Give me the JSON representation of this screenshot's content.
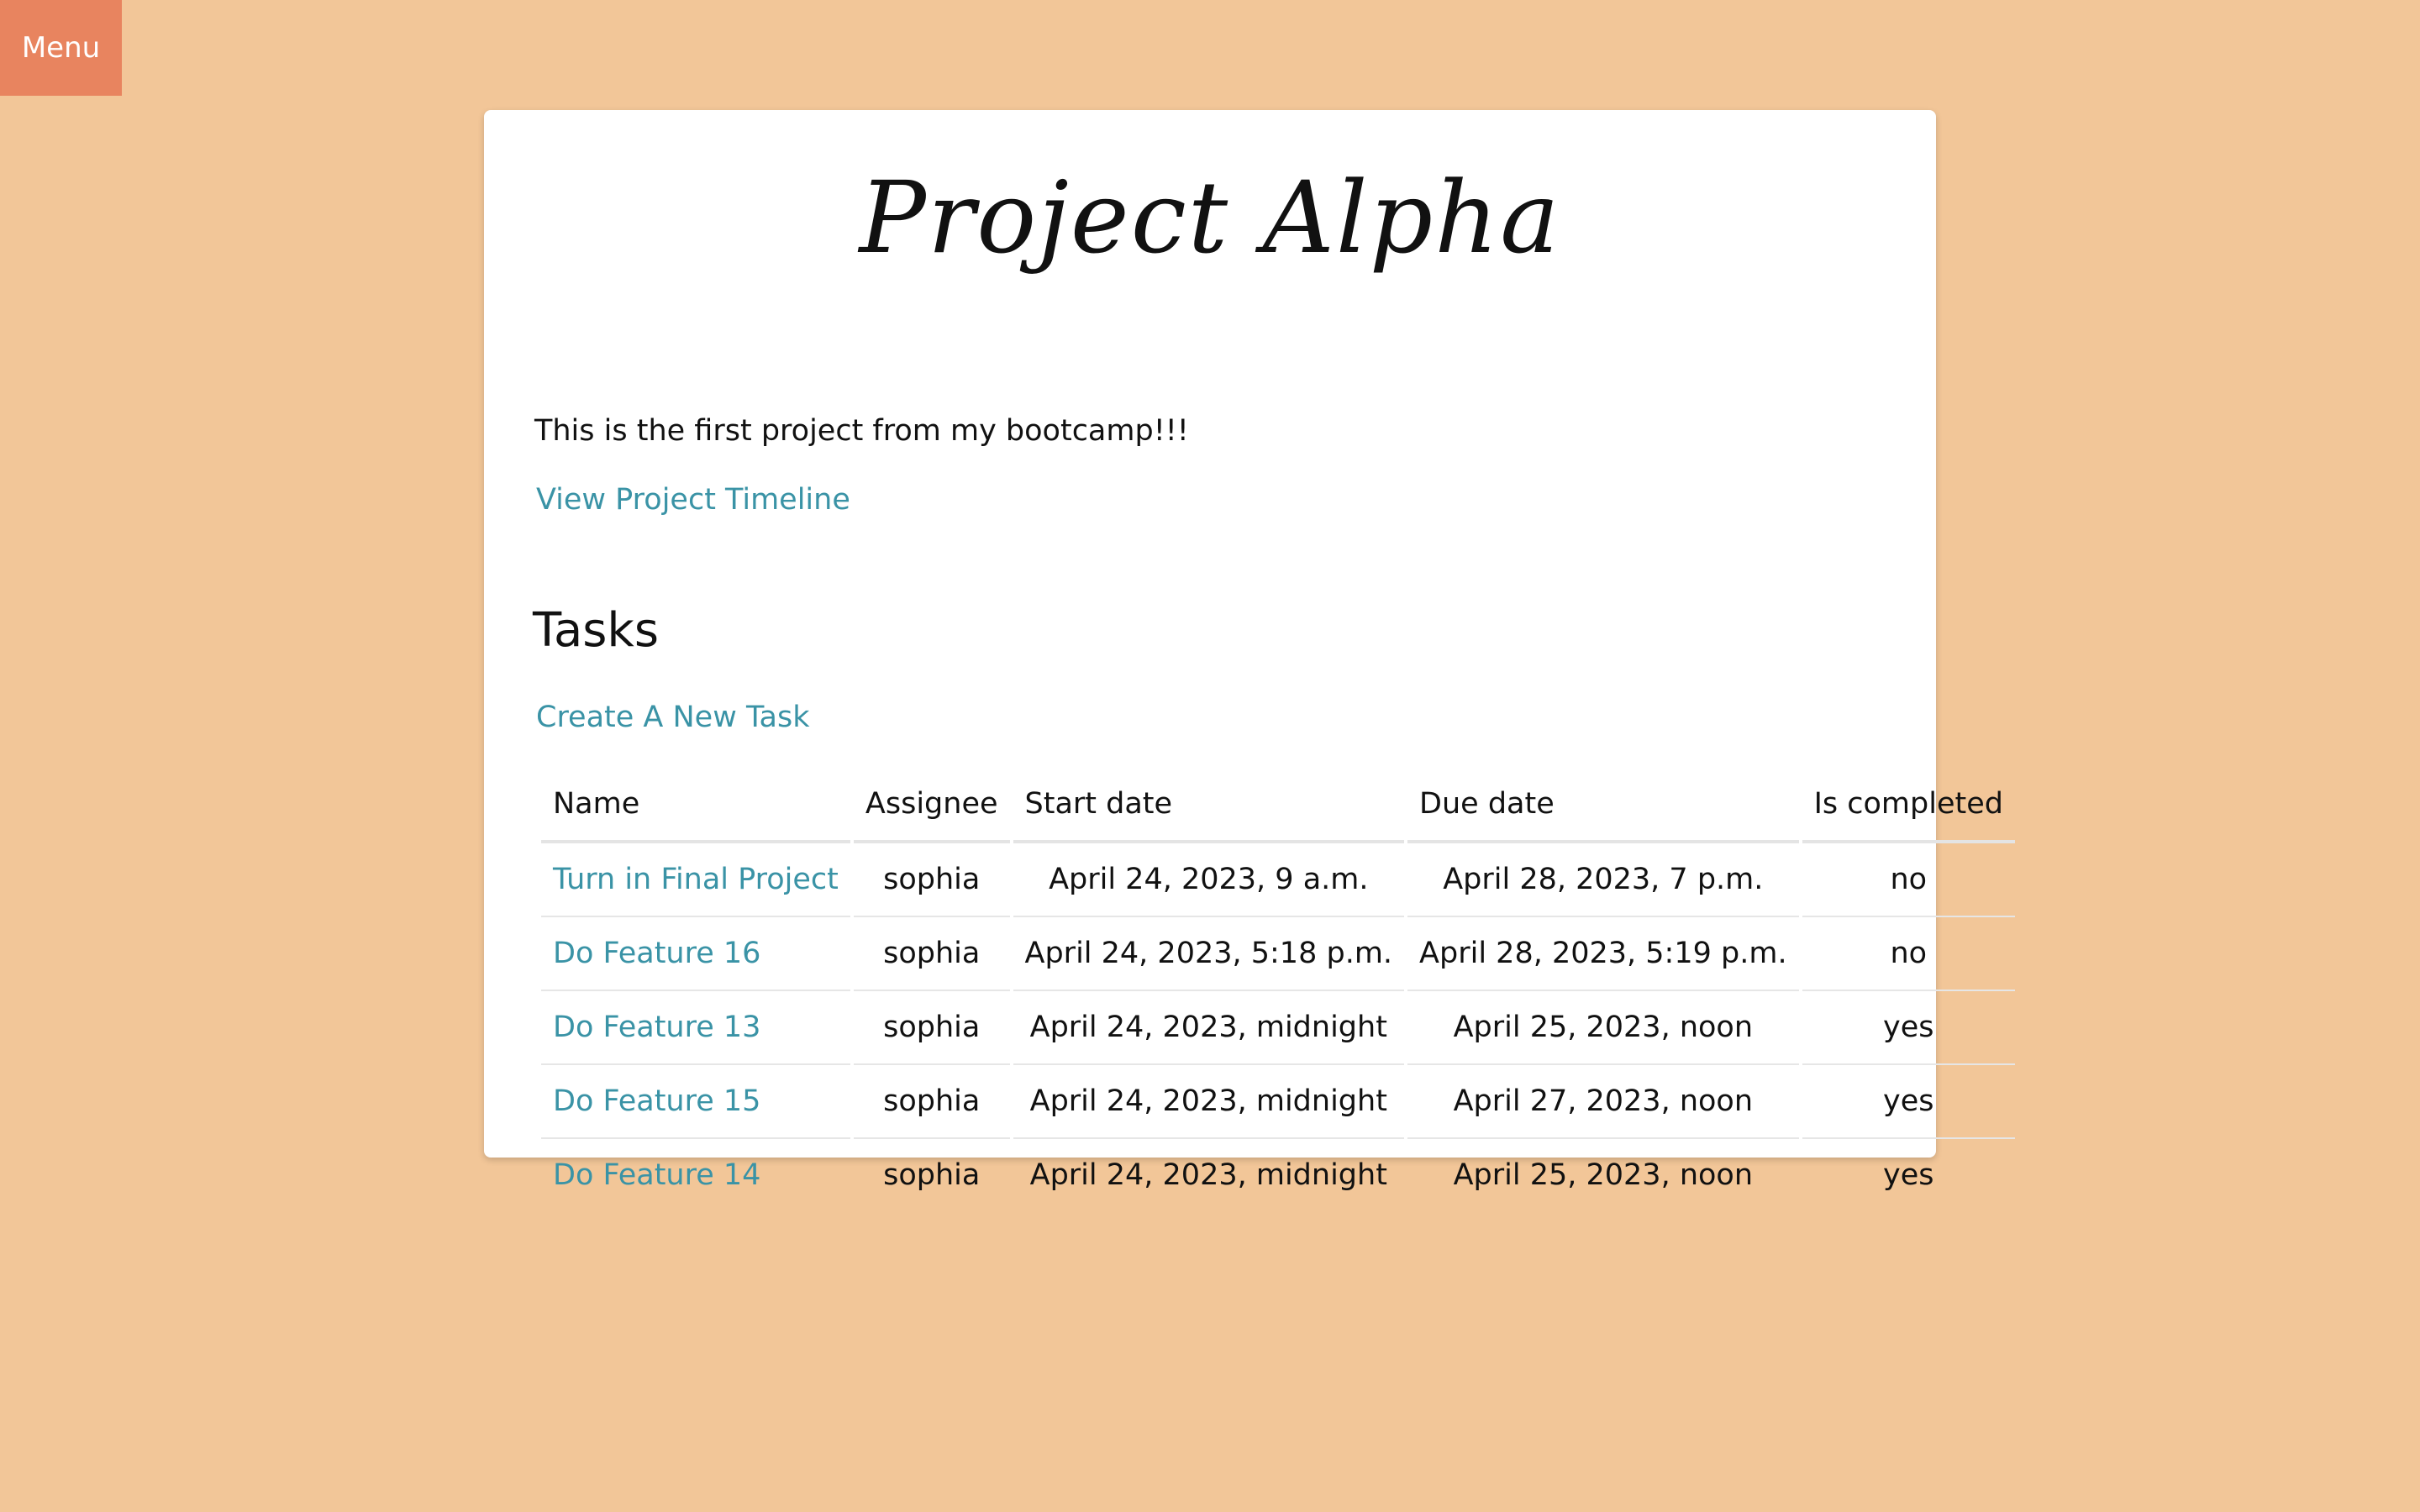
{
  "menu": {
    "label": "Menu"
  },
  "project": {
    "title": "Project Alpha",
    "description": "This is the first project from my bootcamp!!!",
    "timeline_link": "View Project Timeline"
  },
  "tasks": {
    "section_title": "Tasks",
    "create_link": "Create A New Task",
    "columns": [
      "Name",
      "Assignee",
      "Start date",
      "Due date",
      "Is completed"
    ],
    "rows": [
      {
        "name": "Turn in Final Project",
        "assignee": "sophia",
        "start": "April 24, 2023, 9 a.m.",
        "due": "April 28, 2023, 7 p.m.",
        "completed": "no"
      },
      {
        "name": "Do Feature 16",
        "assignee": "sophia",
        "start": "April 24, 2023, 5:18 p.m.",
        "due": "April 28, 2023, 5:19 p.m.",
        "completed": "no"
      },
      {
        "name": "Do Feature 13",
        "assignee": "sophia",
        "start": "April 24, 2023, midnight",
        "due": "April 25, 2023, noon",
        "completed": "yes"
      },
      {
        "name": "Do Feature 15",
        "assignee": "sophia",
        "start": "April 24, 2023, midnight",
        "due": "April 27, 2023, noon",
        "completed": "yes"
      },
      {
        "name": "Do Feature 14",
        "assignee": "sophia",
        "start": "April 24, 2023, midnight",
        "due": "April 25, 2023, noon",
        "completed": "yes"
      }
    ]
  },
  "colors": {
    "background": "#f2c698",
    "menu_button": "#e8845f",
    "card": "#ffffff",
    "link": "#3a93a6",
    "text": "#111111"
  }
}
